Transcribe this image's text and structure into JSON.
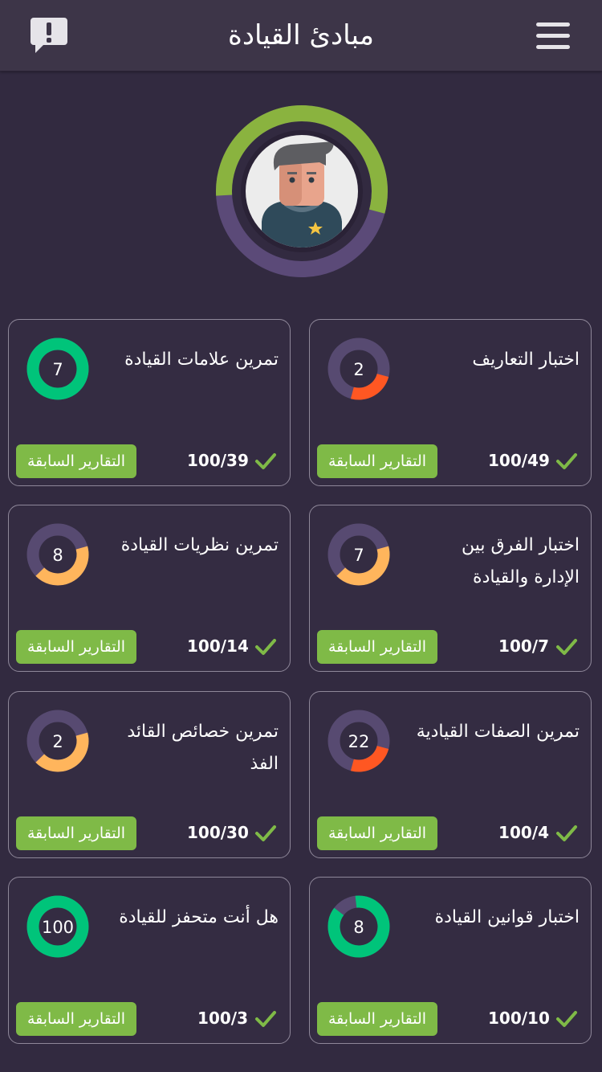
{
  "header": {
    "title": "مبادئ القيادة"
  },
  "colors": {
    "background": "#322a40",
    "topbar": "#3d3548",
    "accent_green": "#7fba47",
    "ring_purple": "#574a71",
    "ring_red": "#ff5722",
    "ring_orange": "#ffb55c",
    "ring_green": "#00c47a"
  },
  "profile": {
    "progress_fraction": 0.55
  },
  "cards": [
    {
      "name": "تمرين علامات القيادة",
      "count": "7",
      "fill": 1.0,
      "fill_color": "#00c47a",
      "score": "100/39",
      "report_label": "التقارير السابقة"
    },
    {
      "name": "اختبار التعاريف",
      "count": "2",
      "fill": 0.25,
      "fill_color": "#ff5722",
      "score": "100/49",
      "report_label": "التقارير السابقة"
    },
    {
      "name": "تمرين نظريات القيادة",
      "count": "8",
      "fill": 0.42,
      "fill_color": "#ffb55c",
      "score": "100/14",
      "report_label": "التقارير السابقة"
    },
    {
      "name": "اختبار الفرق بين الإدارة والقيادة",
      "count": "7",
      "fill": 0.42,
      "fill_color": "#ffb55c",
      "score": "100/7",
      "report_label": "التقارير السابقة"
    },
    {
      "name": "تمرين خصائص القائد الفذ",
      "count": "2",
      "fill": 0.42,
      "fill_color": "#ffb55c",
      "score": "100/30",
      "report_label": "التقارير السابقة"
    },
    {
      "name": "تمرين الصفات القيادية",
      "count": "22",
      "fill": 0.25,
      "fill_color": "#ff5722",
      "score": "100/4",
      "report_label": "التقارير السابقة"
    },
    {
      "name": "هل أنت متحفز للقيادة",
      "count": "100",
      "fill": 1.0,
      "fill_color": "#00c47a",
      "score": "100/3",
      "report_label": "التقارير السابقة"
    },
    {
      "name": "اختبار قوانين القيادة",
      "count": "8",
      "fill": 0.87,
      "fill_color": "#00c47a",
      "score": "100/10",
      "report_label": "التقارير السابقة"
    }
  ]
}
